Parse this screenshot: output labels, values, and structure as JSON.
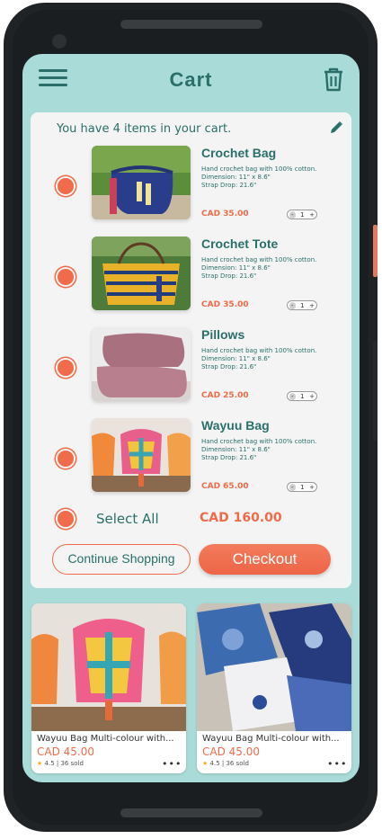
{
  "header": {
    "title": "Cart"
  },
  "cart": {
    "summary": "You have 4 items in your cart.",
    "items": [
      {
        "name": "Crochet Bag",
        "desc1": "Hand crochet bag with 100% cotton.",
        "desc2": "Dimension: 11\" x 8.6\"",
        "desc3": "Strap Drop: 21.6\"",
        "price": "CAD 35.00",
        "minus": "-",
        "qty": "1",
        "plus": "+"
      },
      {
        "name": "Crochet Tote",
        "desc1": "Hand crochet bag with 100% cotton.",
        "desc2": "Dimension: 11\" x 8.6\"",
        "desc3": "Strap Drop: 21.6\"",
        "price": "CAD 35.00",
        "minus": "-",
        "qty": "1",
        "plus": "+"
      },
      {
        "name": "Pillows",
        "desc1": "Hand crochet bag with 100% cotton.",
        "desc2": "Dimension: 11\" x 8.6\"",
        "desc3": "Strap Drop: 21.6\"",
        "price": "CAD 25.00",
        "minus": "-",
        "qty": "1",
        "plus": "+"
      },
      {
        "name": "Wayuu Bag",
        "desc1": "Hand crochet bag with 100% cotton.",
        "desc2": "Dimension: 11\" x 8.6\"",
        "desc3": "Strap Drop: 21.6\"",
        "price": "CAD 65.00",
        "minus": "-",
        "qty": "1",
        "plus": "+"
      }
    ],
    "select_all": "Select All",
    "total": "CAD 160.00",
    "continue_label": "Continue Shopping",
    "checkout_label": "Checkout"
  },
  "recommendations": [
    {
      "name": "Wayuu Bag Multi-colour with...",
      "price": "CAD 45.00",
      "star": "★",
      "rating": "4.5 | 36 sold",
      "more": "•••"
    },
    {
      "name": "Wayuu Bag Multi-colour with...",
      "price": "CAD 45.00",
      "star": "★",
      "rating": "4.5 | 36 sold",
      "more": "•••"
    }
  ],
  "colors": {
    "accent": "#ef6b4a",
    "brand": "#2a6f6a",
    "background": "#a9dcd8"
  },
  "icons": [
    "hamburger-menu-icon",
    "trash-icon",
    "pencil-edit-icon"
  ]
}
